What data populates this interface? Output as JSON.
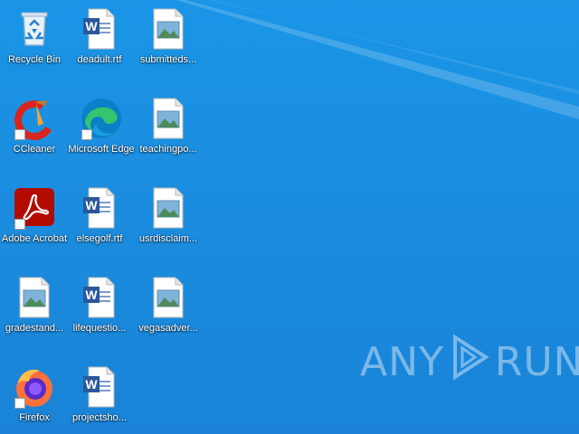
{
  "desktop": {
    "background_color": "#1a8fe2",
    "icons": [
      {
        "label": "Recycle Bin",
        "icon": "recycle-bin-icon",
        "type": "recycle"
      },
      {
        "label": "deadult.rtf",
        "icon": "word-document-icon",
        "type": "word"
      },
      {
        "label": "submitteds...",
        "icon": "image-file-icon",
        "type": "image"
      },
      {
        "label": "CCleaner",
        "icon": "ccleaner-icon",
        "type": "ccleaner"
      },
      {
        "label": "Microsoft Edge",
        "icon": "edge-icon",
        "type": "edge"
      },
      {
        "label": "teachingpo...",
        "icon": "image-file-icon",
        "type": "image"
      },
      {
        "label": "Adobe Acrobat",
        "icon": "acrobat-icon",
        "type": "acrobat"
      },
      {
        "label": "elsegolf.rtf",
        "icon": "word-document-icon",
        "type": "word"
      },
      {
        "label": "usrdisclaim...",
        "icon": "image-file-icon",
        "type": "image"
      },
      {
        "label": "gradestand...",
        "icon": "image-file-icon",
        "type": "image"
      },
      {
        "label": "lifequestio...",
        "icon": "word-document-icon",
        "type": "word"
      },
      {
        "label": "vegasadver...",
        "icon": "image-file-icon",
        "type": "image"
      },
      {
        "label": "Firefox",
        "icon": "firefox-icon",
        "type": "firefox"
      },
      {
        "label": "projectsho...",
        "icon": "word-document-icon",
        "type": "word"
      }
    ]
  },
  "watermark": {
    "left_text": "ANY",
    "right_text": "RUN"
  }
}
